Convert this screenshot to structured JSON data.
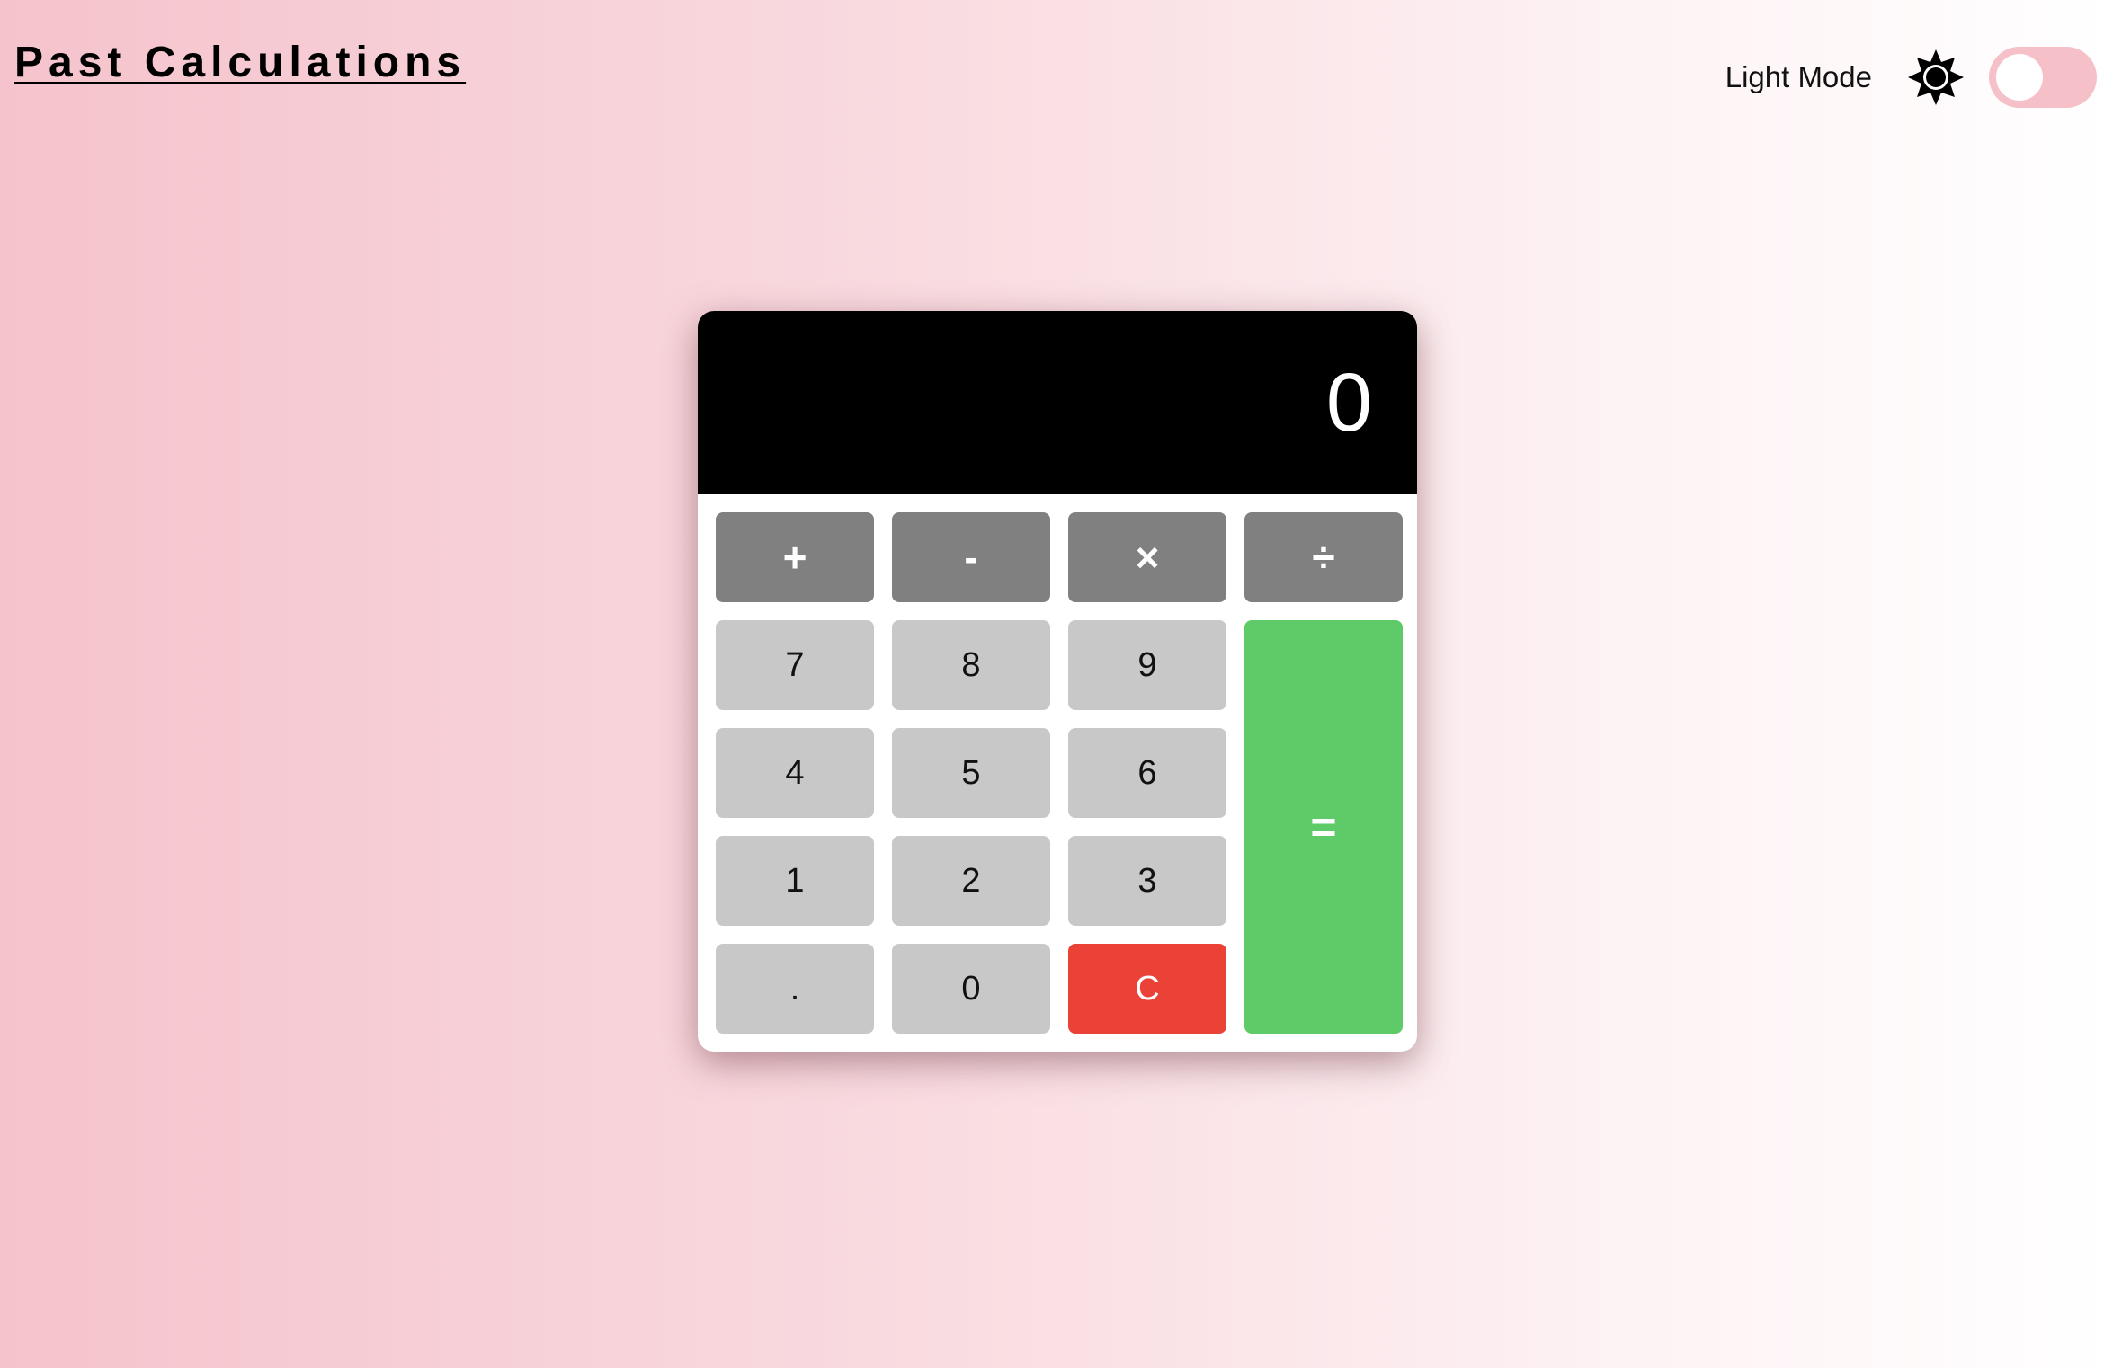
{
  "header": {
    "past_calculations_link": "Past Calculations"
  },
  "theme": {
    "mode_label": "Light Mode",
    "icon": "sun-icon",
    "toggle_on": false,
    "toggle_color": "#f5c0c8"
  },
  "calculator": {
    "display_value": "0",
    "operators": {
      "add": "+",
      "subtract": "-",
      "multiply": "×",
      "divide": "÷"
    },
    "digits": {
      "seven": "7",
      "eight": "8",
      "nine": "9",
      "four": "4",
      "five": "5",
      "six": "6",
      "one": "1",
      "two": "2",
      "three": "3",
      "decimal": ".",
      "zero": "0"
    },
    "clear": "C",
    "equals": "=",
    "colors": {
      "display_bg": "#000000",
      "operator": "#808080",
      "digit": "#c8c8c8",
      "clear": "#ea4237",
      "equals": "#5fcb68"
    }
  }
}
